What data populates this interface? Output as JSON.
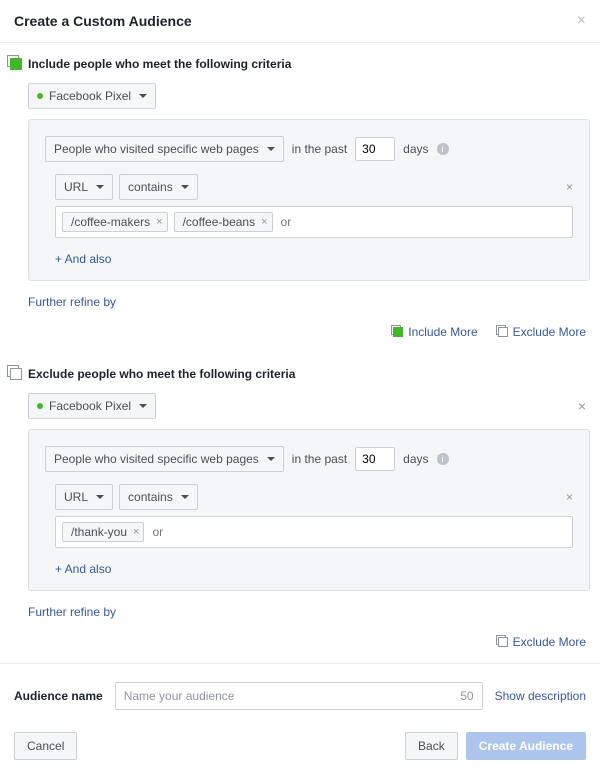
{
  "header": {
    "title": "Create a Custom Audience"
  },
  "include": {
    "section_label": "Include people who meet the following criteria",
    "pixel_label": "Facebook Pixel",
    "rule_type": "People who visited specific web pages",
    "in_the_past": "in the past",
    "days_value": "30",
    "days_word": "days",
    "filter_field": "URL",
    "filter_op": "contains",
    "tokens": [
      "/coffee-makers",
      "/coffee-beans"
    ],
    "or_placeholder": "or",
    "and_also": "+ And also",
    "refine": "Further refine by"
  },
  "mid_actions": {
    "include_more": "Include More",
    "exclude_more": "Exclude More"
  },
  "exclude": {
    "section_label": "Exclude people who meet the following criteria",
    "pixel_label": "Facebook Pixel",
    "rule_type": "People who visited specific web pages",
    "in_the_past": "in the past",
    "days_value": "30",
    "days_word": "days",
    "filter_field": "URL",
    "filter_op": "contains",
    "tokens": [
      "/thank-you"
    ],
    "or_placeholder": "or",
    "and_also": "+ And also",
    "refine": "Further refine by"
  },
  "bottom_actions": {
    "exclude_more": "Exclude More"
  },
  "footer": {
    "name_label": "Audience name",
    "name_placeholder": "Name your audience",
    "char_count": "50",
    "show_desc": "Show description",
    "cancel": "Cancel",
    "back": "Back",
    "create": "Create Audience"
  }
}
